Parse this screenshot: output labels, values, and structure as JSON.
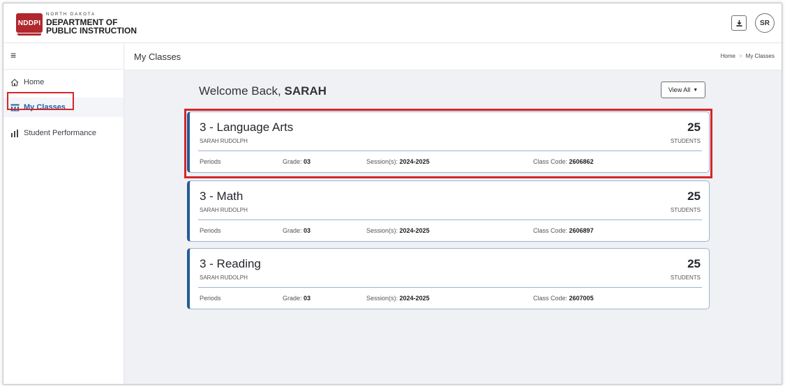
{
  "header": {
    "logo_badge": "NDDPI",
    "logo_small": "NORTH DAKOTA",
    "logo_line1": "DEPARTMENT OF",
    "logo_line2": "PUBLIC INSTRUCTION",
    "avatar_initials": "SR",
    "download_icon": "download-icon"
  },
  "sidebar": {
    "menu_icon": "≡",
    "items": [
      {
        "label": "Home",
        "icon": "home-icon",
        "active": false
      },
      {
        "label": "My Classes",
        "icon": "classes-icon",
        "active": true
      },
      {
        "label": "Student Performance",
        "icon": "bar-chart-icon",
        "active": false
      }
    ]
  },
  "page": {
    "title": "My Classes",
    "breadcrumb": [
      "Home",
      "My Classes"
    ]
  },
  "main": {
    "welcome_prefix": "Welcome Back, ",
    "welcome_name": "SARAH",
    "view_all_label": "View All",
    "classes": [
      {
        "name": "3 - Language Arts",
        "teacher": "SARAH RUDOLPH",
        "count": "25",
        "count_label": "STUDENTS",
        "periods_label": "Periods",
        "grade_label": "Grade: ",
        "grade": "03",
        "session_label": "Session(s): ",
        "session": "2024-2025",
        "code_label": "Class Code: ",
        "code": "2606862"
      },
      {
        "name": "3 - Math",
        "teacher": "SARAH RUDOLPH",
        "count": "25",
        "count_label": "STUDENTS",
        "periods_label": "Periods",
        "grade_label": "Grade: ",
        "grade": "03",
        "session_label": "Session(s): ",
        "session": "2024-2025",
        "code_label": "Class Code: ",
        "code": "2606897"
      },
      {
        "name": "3 - Reading",
        "teacher": "SARAH RUDOLPH",
        "count": "25",
        "count_label": "STUDENTS",
        "periods_label": "Periods",
        "grade_label": "Grade: ",
        "grade": "03",
        "session_label": "Session(s): ",
        "session": "2024-2025",
        "code_label": "Class Code: ",
        "code": "2607005"
      }
    ]
  },
  "colors": {
    "accent": "#245b93",
    "highlight": "#d6252a",
    "brand": "#b1272d"
  }
}
